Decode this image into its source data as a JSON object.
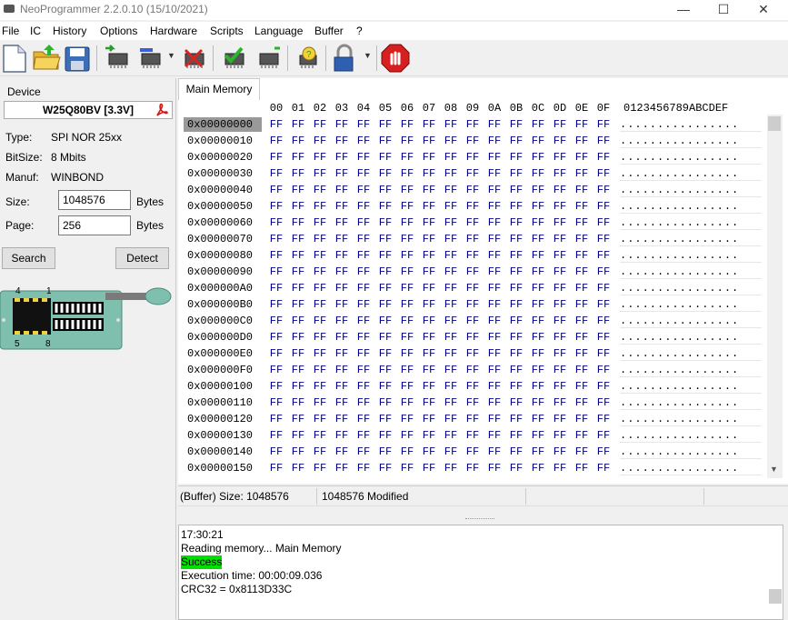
{
  "window": {
    "title": "NeoProgrammer 2.2.0.10 (15/10/2021)"
  },
  "menu": [
    "File",
    "IC",
    "History",
    "Options",
    "Hardware",
    "Scripts",
    "Language",
    "Buffer",
    "?"
  ],
  "toolbar": {
    "buttons": [
      "new-file-icon",
      "open-folder-icon",
      "save-disk-icon",
      "read-chip-icon",
      "write-chip-icon",
      "erase-chip-icon",
      "verify-chip-icon",
      "blank-check-icon",
      "auto-detect-icon",
      "protect-lock-icon",
      "stop-icon"
    ]
  },
  "device": {
    "label": "Device",
    "name": "W25Q80BV [3.3V]",
    "type_label": "Type:",
    "type_value": "SPI NOR 25xx",
    "bitsize_label": "BitSize:",
    "bitsize_value": "8 Mbits",
    "manuf_label": "Manuf:",
    "manuf_value": "WINBOND",
    "size_label": "Size:",
    "size_value": "1048576",
    "size_unit": "Bytes",
    "page_label": "Page:",
    "page_value": "256",
    "page_unit": "Bytes",
    "search_button": "Search",
    "detect_button": "Detect",
    "chip_pin_top_left": "4",
    "chip_pin_top_right": "1",
    "chip_pin_bottom_left": "5",
    "chip_pin_bottom_right": "8"
  },
  "tab": {
    "label": "Main Memory"
  },
  "hex": {
    "columns": [
      "00",
      "01",
      "02",
      "03",
      "04",
      "05",
      "06",
      "07",
      "08",
      "09",
      "0A",
      "0B",
      "0C",
      "0D",
      "0E",
      "0F"
    ],
    "ascii_header": "0123456789ABCDEF",
    "rows": [
      "0x00000000",
      "0x00000010",
      "0x00000020",
      "0x00000030",
      "0x00000040",
      "0x00000050",
      "0x00000060",
      "0x00000070",
      "0x00000080",
      "0x00000090",
      "0x000000A0",
      "0x000000B0",
      "0x000000C0",
      "0x000000D0",
      "0x000000E0",
      "0x000000F0",
      "0x00000100",
      "0x00000110",
      "0x00000120",
      "0x00000130",
      "0x00000140",
      "0x00000150"
    ],
    "byte_value": "FF",
    "ascii_value": "................"
  },
  "status": {
    "buffer_size": "(Buffer) Size: 1048576",
    "modified": "1048576 Modified"
  },
  "log": {
    "time": "17:30:21",
    "reading": "Reading memory... Main Memory",
    "result": "Success",
    "exec_time": "Execution time: 00:00:09.036",
    "crc": "CRC32 = 0x8113D33C"
  },
  "colors": {
    "success": "#00e000",
    "hex_text": "#00008b",
    "selection": "#999999"
  }
}
